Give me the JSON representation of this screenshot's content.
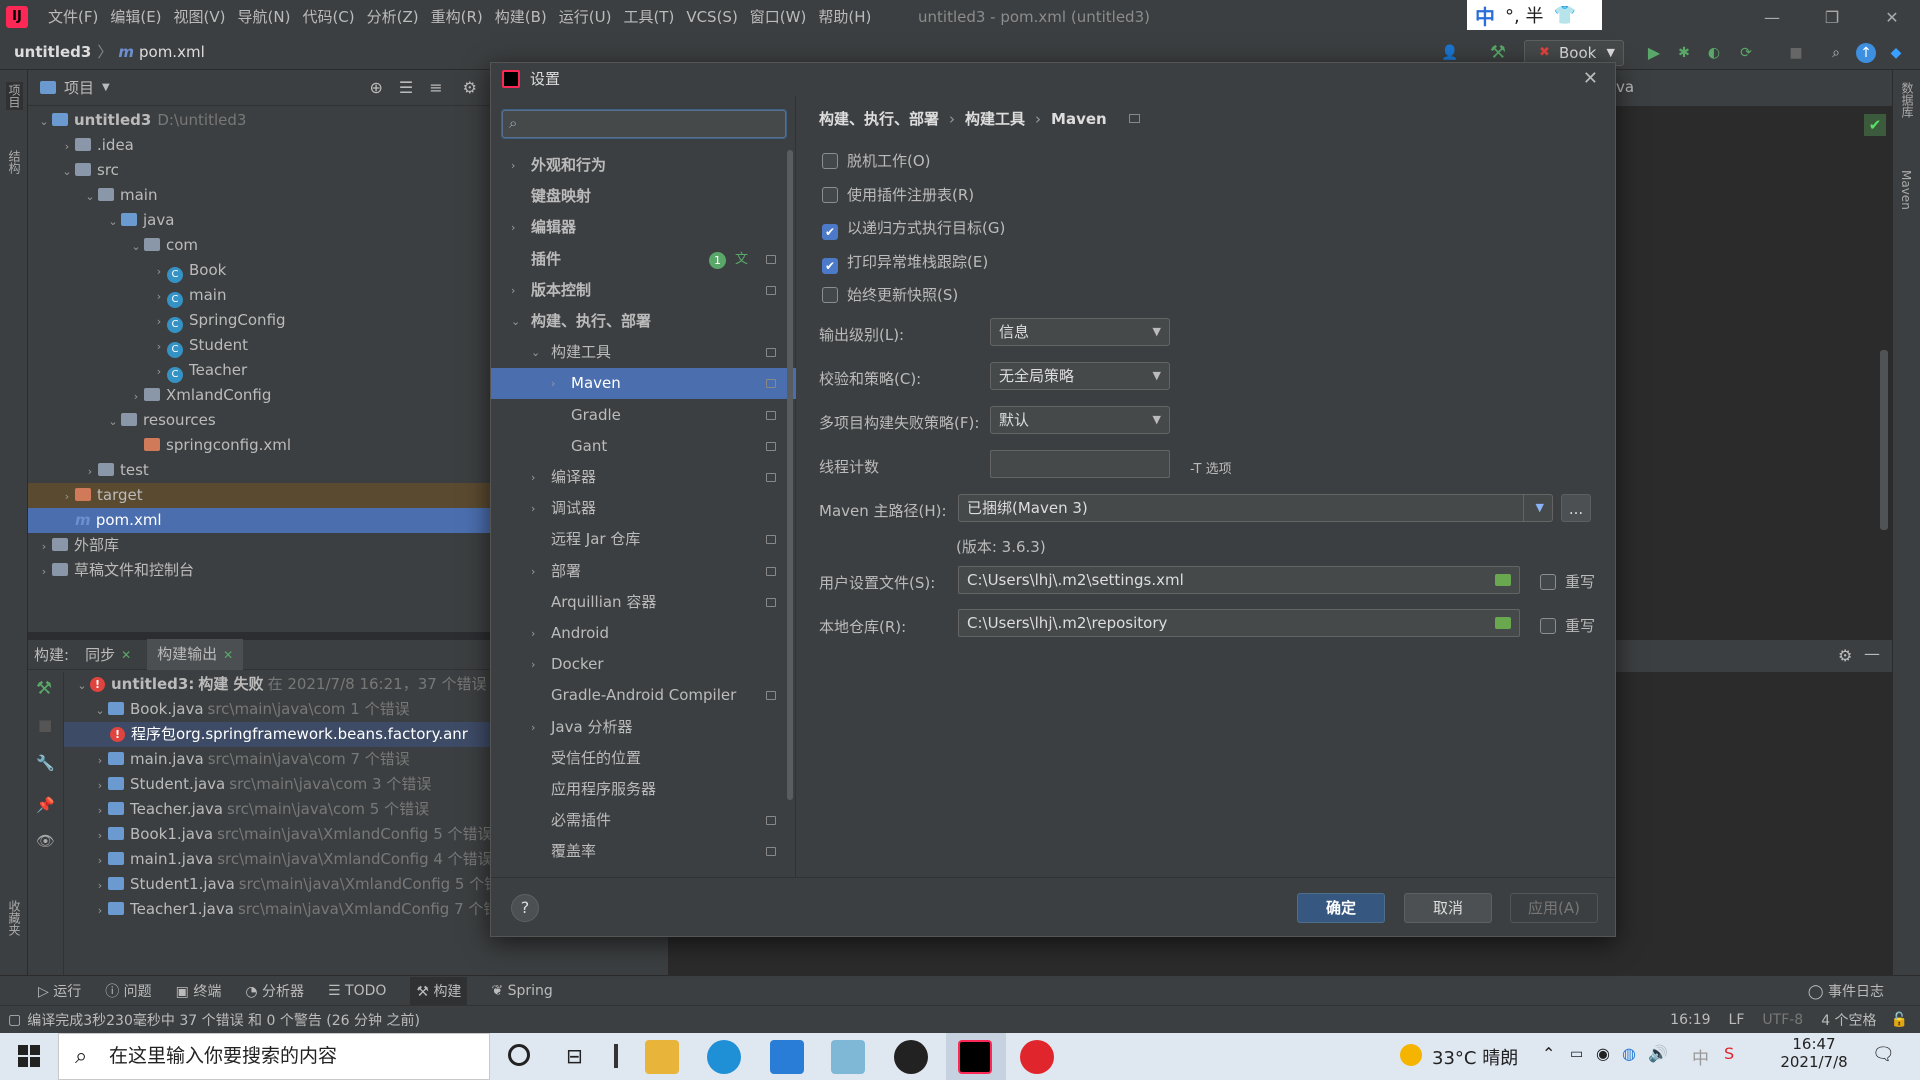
{
  "menubar": {
    "logo": "IJ",
    "items": [
      "文件(F)",
      "编辑(E)",
      "视图(V)",
      "导航(N)",
      "代码(C)",
      "分析(Z)",
      "重构(R)",
      "构建(B)",
      "运行(U)",
      "工具(T)",
      "VCS(S)",
      "窗口(W)",
      "帮助(H)"
    ],
    "window_title": "untitled3 - pom.xml (untitled3)",
    "ime": "中 °, 半",
    "min": "—",
    "max": "❐",
    "close": "✕"
  },
  "navbar": {
    "project": "untitled3",
    "file": "pom.xml",
    "run_config": "Book"
  },
  "left_stripe": {
    "project": "项目",
    "structure": "结构",
    "favorites": "收藏夹"
  },
  "right_stripe": {
    "database": "数据库",
    "maven": "Maven"
  },
  "project_panel": {
    "title": "项目",
    "tree": [
      {
        "label": "untitled3",
        "extra": "D:\\untitled3"
      },
      {
        "label": ".idea"
      },
      {
        "label": "src"
      },
      {
        "label": "main"
      },
      {
        "label": "java"
      },
      {
        "label": "com"
      },
      {
        "label": "Book"
      },
      {
        "label": "main"
      },
      {
        "label": "SpringConfig"
      },
      {
        "label": "Student"
      },
      {
        "label": "Teacher"
      },
      {
        "label": "XmlandConfig"
      },
      {
        "label": "resources"
      },
      {
        "label": "springconfig.xml"
      },
      {
        "label": "test"
      },
      {
        "label": "target"
      },
      {
        "label": "pom.xml"
      },
      {
        "label": "外部库"
      },
      {
        "label": "草稿文件和控制台"
      }
    ]
  },
  "build_panel": {
    "label": "构建:",
    "tab_sync": "同步",
    "tab_output": "构建输出",
    "rows": [
      {
        "label": "untitled3:",
        "bold": "构建 失败",
        "extra": "在 2021/7/8 16:21，37 个错误"
      },
      {
        "label": "Book.java",
        "extra": "src\\main\\java\\com 1 个错误"
      },
      {
        "label": "程序包org.springframework.beans.factory.anr",
        "extra": ""
      },
      {
        "label": "main.java",
        "extra": "src\\main\\java\\com 7 个错误"
      },
      {
        "label": "Student.java",
        "extra": "src\\main\\java\\com 3 个错误"
      },
      {
        "label": "Teacher.java",
        "extra": "src\\main\\java\\com 5 个错误"
      },
      {
        "label": "Book1.java",
        "extra": "src\\main\\java\\XmlandConfig 5 个错误"
      },
      {
        "label": "main1.java",
        "extra": "src\\main\\java\\XmlandConfig 4 个错误"
      },
      {
        "label": "Student1.java",
        "extra": "src\\main\\java\\XmlandConfig 5 个错"
      },
      {
        "label": "Teacher1.java",
        "extra": "src\\main\\java\\XmlandConfig 7 个错"
      }
    ]
  },
  "editor": {
    "tab_fragment": "va"
  },
  "bottom_tools": [
    "运行",
    "问题",
    "终端",
    "分析器",
    "TODO",
    "构建",
    "Spring"
  ],
  "event_log": "事件日志",
  "status": {
    "message": "编译完成3秒230毫秒中 37 个错误 和 0 个警告 (26 分钟 之前)",
    "pos": "16:19",
    "le": "LF",
    "enc": "UTF-8",
    "indent": "4 个空格"
  },
  "taskbar": {
    "search_placeholder": "在这里输入你要搜索的内容",
    "weather": "33°C  晴朗",
    "ime": "中",
    "time": "16:47",
    "date": "2021/7/8"
  },
  "dialog": {
    "title": "设置",
    "close": "✕",
    "search_placeholder": "",
    "sidebar": [
      {
        "label": "外观和行为",
        "arrow": "›",
        "indent": 0,
        "bold": true
      },
      {
        "label": "键盘映射",
        "arrow": "",
        "indent": 0,
        "bold": true
      },
      {
        "label": "编辑器",
        "arrow": "›",
        "indent": 0,
        "bold": true
      },
      {
        "label": "插件",
        "arrow": "",
        "indent": 0,
        "bold": true,
        "badge": "1",
        "cfg": true
      },
      {
        "label": "版本控制",
        "arrow": "›",
        "indent": 0,
        "bold": true,
        "cfg": true
      },
      {
        "label": "构建、执行、部署",
        "arrow": "⌄",
        "indent": 0,
        "bold": true
      },
      {
        "label": "构建工具",
        "arrow": "⌄",
        "indent": 1,
        "cfg": true
      },
      {
        "label": "Maven",
        "arrow": "›",
        "indent": 2,
        "cfg": true,
        "selected": true
      },
      {
        "label": "Gradle",
        "arrow": "",
        "indent": 2,
        "cfg": true
      },
      {
        "label": "Gant",
        "arrow": "",
        "indent": 2,
        "cfg": true
      },
      {
        "label": "编译器",
        "arrow": "›",
        "indent": 1,
        "cfg": true
      },
      {
        "label": "调试器",
        "arrow": "›",
        "indent": 1
      },
      {
        "label": "远程 Jar 仓库",
        "arrow": "",
        "indent": 1,
        "cfg": true
      },
      {
        "label": "部署",
        "arrow": "›",
        "indent": 1,
        "cfg": true
      },
      {
        "label": "Arquillian 容器",
        "arrow": "",
        "indent": 1,
        "cfg": true
      },
      {
        "label": "Android",
        "arrow": "›",
        "indent": 1
      },
      {
        "label": "Docker",
        "arrow": "›",
        "indent": 1
      },
      {
        "label": "Gradle-Android Compiler",
        "arrow": "",
        "indent": 1,
        "cfg": true
      },
      {
        "label": "Java 分析器",
        "arrow": "›",
        "indent": 1
      },
      {
        "label": "受信任的位置",
        "arrow": "",
        "indent": 1
      },
      {
        "label": "应用程序服务器",
        "arrow": "",
        "indent": 1
      },
      {
        "label": "必需插件",
        "arrow": "",
        "indent": 1,
        "cfg": true
      },
      {
        "label": "覆盖率",
        "arrow": "",
        "indent": 1,
        "cfg": true
      }
    ],
    "breadcrumb": {
      "a": "构建、执行、部署",
      "b": "构建工具",
      "c": "Maven",
      "sep": "›"
    },
    "checkboxes": [
      {
        "label": "脱机工作(O)",
        "checked": false
      },
      {
        "label": "使用插件注册表(R)",
        "checked": false
      },
      {
        "label": "以递归方式执行目标(G)",
        "checked": true
      },
      {
        "label": "打印异常堆栈跟踪(E)",
        "checked": true
      },
      {
        "label": "始终更新快照(S)",
        "checked": false
      }
    ],
    "output_level": {
      "label": "输出级别(L):",
      "value": "信息"
    },
    "checksum": {
      "label": "校验和策略(C):",
      "value": "无全局策略"
    },
    "fail_policy": {
      "label": "多项目构建失败策略(F):",
      "value": "默认"
    },
    "threads": {
      "label": "线程计数",
      "value": "",
      "hint": "-T 选项"
    },
    "maven_home": {
      "label": "Maven 主路径(H):",
      "value": "已捆绑(Maven 3)",
      "browse": "...",
      "version": "(版本: 3.6.3)"
    },
    "user_settings": {
      "label": "用户设置文件(S):",
      "value": "C:\\Users\\lhj\\.m2\\settings.xml",
      "override": "重写"
    },
    "local_repo": {
      "label": "本地仓库(R):",
      "value": "C:\\Users\\lhj\\.m2\\repository",
      "override": "重写"
    },
    "help": "?",
    "ok": "确定",
    "cancel": "取消",
    "apply": "应用(A)"
  },
  "colors": {
    "accent": "#4b6eaf",
    "primary_button": "#365880",
    "error": "#e0443e",
    "ok_green": "#59a869"
  }
}
